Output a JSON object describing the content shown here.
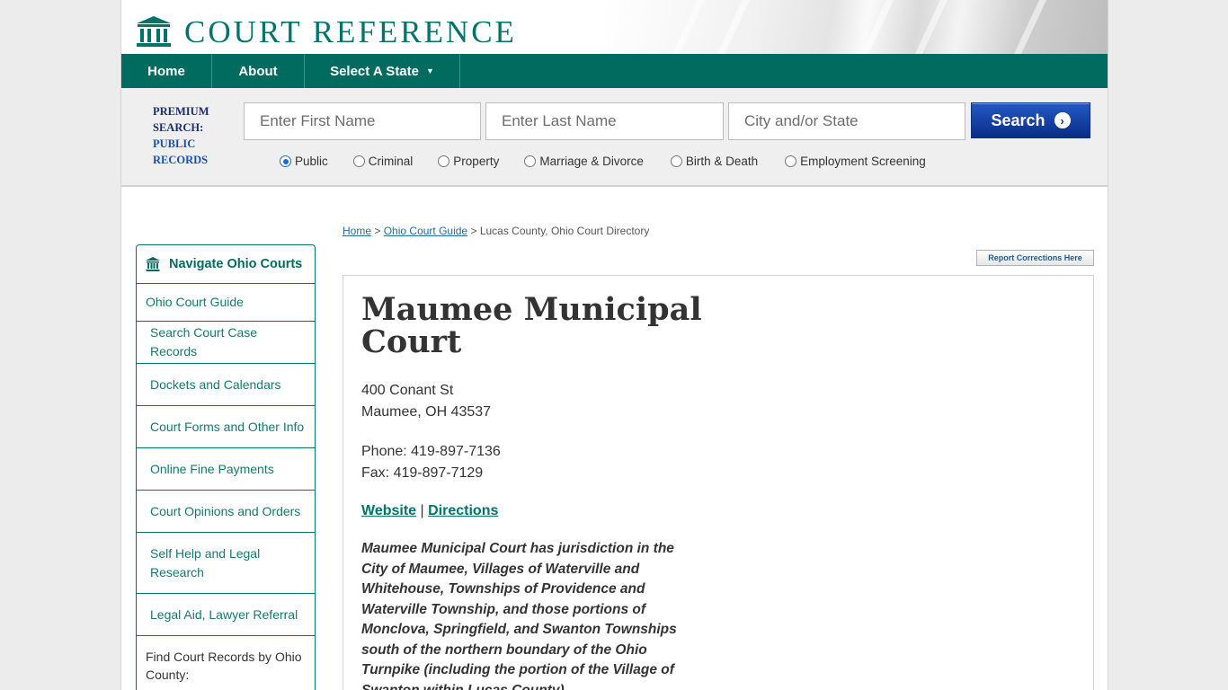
{
  "header": {
    "logo_text": "COURT REFERENCE"
  },
  "nav": {
    "items": [
      {
        "label": "Home"
      },
      {
        "label": "About"
      },
      {
        "label": "Select A State"
      }
    ]
  },
  "search": {
    "premium_line1": "PREMIUM",
    "premium_line2": "SEARCH:",
    "premium_line3": "PUBLIC",
    "premium_line4": "RECORDS",
    "first_name_placeholder": "Enter First Name",
    "last_name_placeholder": "Enter Last Name",
    "city_placeholder": "City and/or State",
    "button_label": "Search",
    "radios": [
      {
        "label": "Public",
        "selected": true
      },
      {
        "label": "Criminal",
        "selected": false
      },
      {
        "label": "Property",
        "selected": false
      },
      {
        "label": "Marriage & Divorce",
        "selected": false
      },
      {
        "label": "Birth & Death",
        "selected": false
      },
      {
        "label": "Employment Screening",
        "selected": false
      }
    ]
  },
  "breadcrumb": {
    "home": "Home",
    "sep1": ">",
    "guide": "Ohio Court Guide",
    "sep2": ">",
    "current": "Lucas County, Ohio Court Directory"
  },
  "report_button": "Report Corrections Here",
  "sidebar": {
    "title": "Navigate Ohio Courts",
    "items": [
      {
        "label": "Ohio Court Guide"
      },
      {
        "label": "Search Court Case Records"
      },
      {
        "label": "Dockets and Calendars"
      },
      {
        "label": "Court Forms and Other Info"
      },
      {
        "label": "Online Fine Payments"
      },
      {
        "label": "Court Opinions and Orders"
      },
      {
        "label": "Self Help and Legal Research"
      },
      {
        "label": "Legal Aid, Lawyer Referral"
      }
    ],
    "footer": "Find Court Records by Ohio County:"
  },
  "court": {
    "title": "Maumee Municipal Court",
    "address_line1": "400 Conant St",
    "address_line2": "Maumee, OH 43537",
    "phone": "Phone: 419-897-7136",
    "fax": "Fax: 419-897-7129",
    "website_link": "Website",
    "link_sep": "|",
    "directions_link": "Directions",
    "jurisdiction": "Maumee Municipal Court has jurisdiction in the City of Maumee, Villages of Waterville and Whitehouse, Townships of Providence and Waterville Township, and those portions of Monclova, Springfield, and Swanton Townships south of the northern boundary of the Ohio Turnpike (including the portion of the Village of Swanton within Lucas County)."
  },
  "colors": {
    "brand_teal": "#006b5e",
    "search_button": "#0a2c86",
    "link": "#1f6e99"
  }
}
